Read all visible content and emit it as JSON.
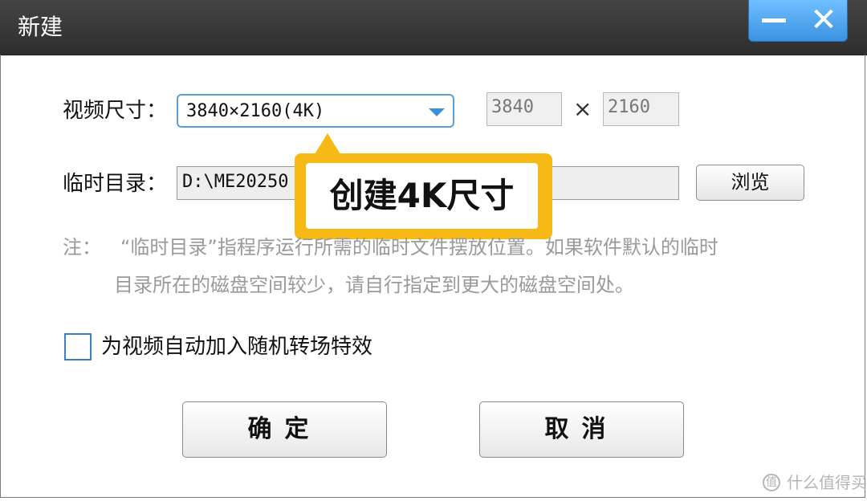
{
  "window": {
    "title": "新建",
    "minimize_icon": "minimize-icon",
    "close_icon": "close-icon",
    "close_glyph": "✕",
    "accent_color": "#3a92e0"
  },
  "video_size": {
    "label": "视频尺寸：",
    "selected": "3840×2160(4K)",
    "width": "3840",
    "times": "×",
    "height": "2160"
  },
  "temp_dir": {
    "label": "临时目录：",
    "path": "D:\\ME20250",
    "browse_label": "浏览"
  },
  "callout": {
    "text": "创建4K尺寸",
    "color": "#f6b915"
  },
  "note": {
    "prefix": "注：",
    "line1": "“临时目录”指程序运行所需的临时文件摆放位置。如果软件默认的临时",
    "line2": "目录所在的磁盘空间较少，请自行指定到更大的磁盘空间处。"
  },
  "random_transition": {
    "label": "为视频自动加入随机转场特效",
    "checked": false
  },
  "buttons": {
    "ok_label": "确定",
    "cancel_label": "取消"
  },
  "watermark": {
    "icon_glyph": "值",
    "text": "什么值得买"
  }
}
